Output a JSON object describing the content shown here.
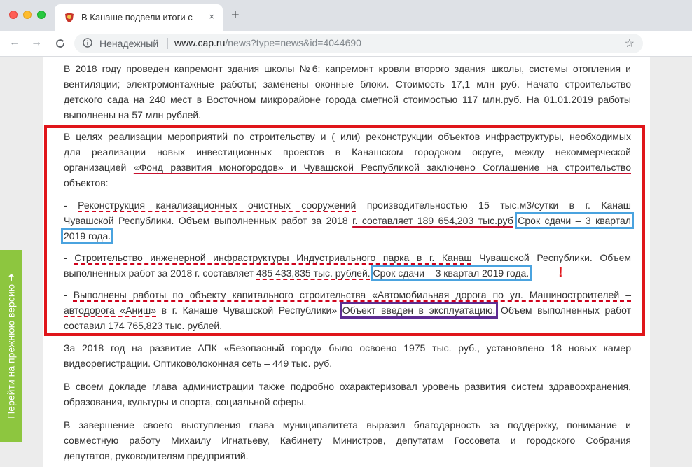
{
  "browser": {
    "tab_title": "В Канаше подвели итоги соци",
    "tab_close": "×",
    "new_tab": "+",
    "nav_back": "←",
    "nav_forward": "→",
    "nav_reload": "C",
    "security_label": "Ненадежный",
    "url_host": "www.cap.ru",
    "url_path": "/news?type=news&id=4044690",
    "bookmark_star": "☆",
    "menu": "⋮"
  },
  "article": {
    "p1": [
      "В 2018 году проведен капремонт здания школы №6: капремонт кровли второго здания школы, системы отопления и",
      "вентиляции; электромонтажные работы; заменены оконные блоки. Стоимость 17,1 млн руб. Начато строительство",
      "детского сада на 240 мест в Восточном микрорайоне города сметной стоимостью 117 млн.руб. На 01.01.2019 работы",
      "выполнены на 57 млн рублей."
    ],
    "p2_l1": "В целях реализации мероприятий по строительству и ( или) реконструкции объектов инфраструктуры, необходимых",
    "p2_l2": "для реализации новых инвестиционных проектов в Канашском городском округе, между некоммерческой",
    "p2_l3_a": "организацией",
    "p2_l3_b": "«Фонд развития моногородов» и Чувашской Республикой заключено Соглашение на строительство",
    "p2_l4": "объектов:",
    "p3_l1_a": "-",
    "p3_l1_b": "Реконструкция канализационных очистных сооружений",
    "p3_l1_c": "производительностью 15 тыс.м3/сутки в г. Канаш",
    "p3_l2_a": "Чувашской Республики. Объем выполненных работ за 2018",
    "p3_l2_b": "г. составляет 189 654,203 тыс.руб",
    "p3_l2_c": "Срок сдачи – 3 квартал",
    "p3_l3": "2019 года.",
    "p4_l1_a": "-",
    "p4_l1_b": "Строительство инженерной инфраструктуры Индустриального парка в г. Канаш",
    "p4_l1_c": "Чувашской Республики. Объем",
    "p4_l2_a": "выполненных работ за 2018 г. составляет",
    "p4_l2_b": "485 433,835 тыс. рублей.",
    "p4_l2_c": "Срок сдачи – 3 квартал 2019 года.",
    "p5_l1_a": "-",
    "p5_l1_b": "Выполнены работы по объекту капитального строительства «Автомобильная дорога по ул. Машиностроителей –",
    "p5_l2_a": "автодорога «Аниш»",
    "p5_l2_b": "в г. Канаше Чувашской Республики»",
    "p5_l2_c": "Объект введен в эксплуатацию.",
    "p5_l2_d": "Объем выполненных работ",
    "p5_l3": "составил 174 765,823 тыс. рублей.",
    "p6": [
      "За 2018 год на развитие АПК «Безопасный город» было освоено 1975 тыс. руб., установлено 18 новых камер",
      "видеорегистрации. Оптиковолоконная сеть – 449 тыс. руб."
    ],
    "p7": [
      "В своем докладе глава администрации также подробно охарактеризовал уровень развития систем здравоохранения,",
      "образования, культуры и спорта, социальной сферы."
    ],
    "p8": [
      "В завершение своего выступления глава муниципалитета выразил благодарность за поддержку, понимание и",
      "совместную работу Михаилу Игнатьеву, Кабинету Министров, депутатам Госсовета и городского Собрания",
      "депутатов, руководителям предприятий."
    ]
  },
  "annotations": {
    "exclamation": "!",
    "frame_color": "#e0151a",
    "blue_box_color": "#4aa3df",
    "purple_box_color": "#5e2d91"
  },
  "sidebar": {
    "old_version_label": "Перейти на прежнюю версию ➜",
    "color": "#8dc63f"
  },
  "icons": {
    "favicon": "coat-of-arms-icon",
    "info": "info-circle-icon",
    "extension": "extension-face-icon"
  }
}
